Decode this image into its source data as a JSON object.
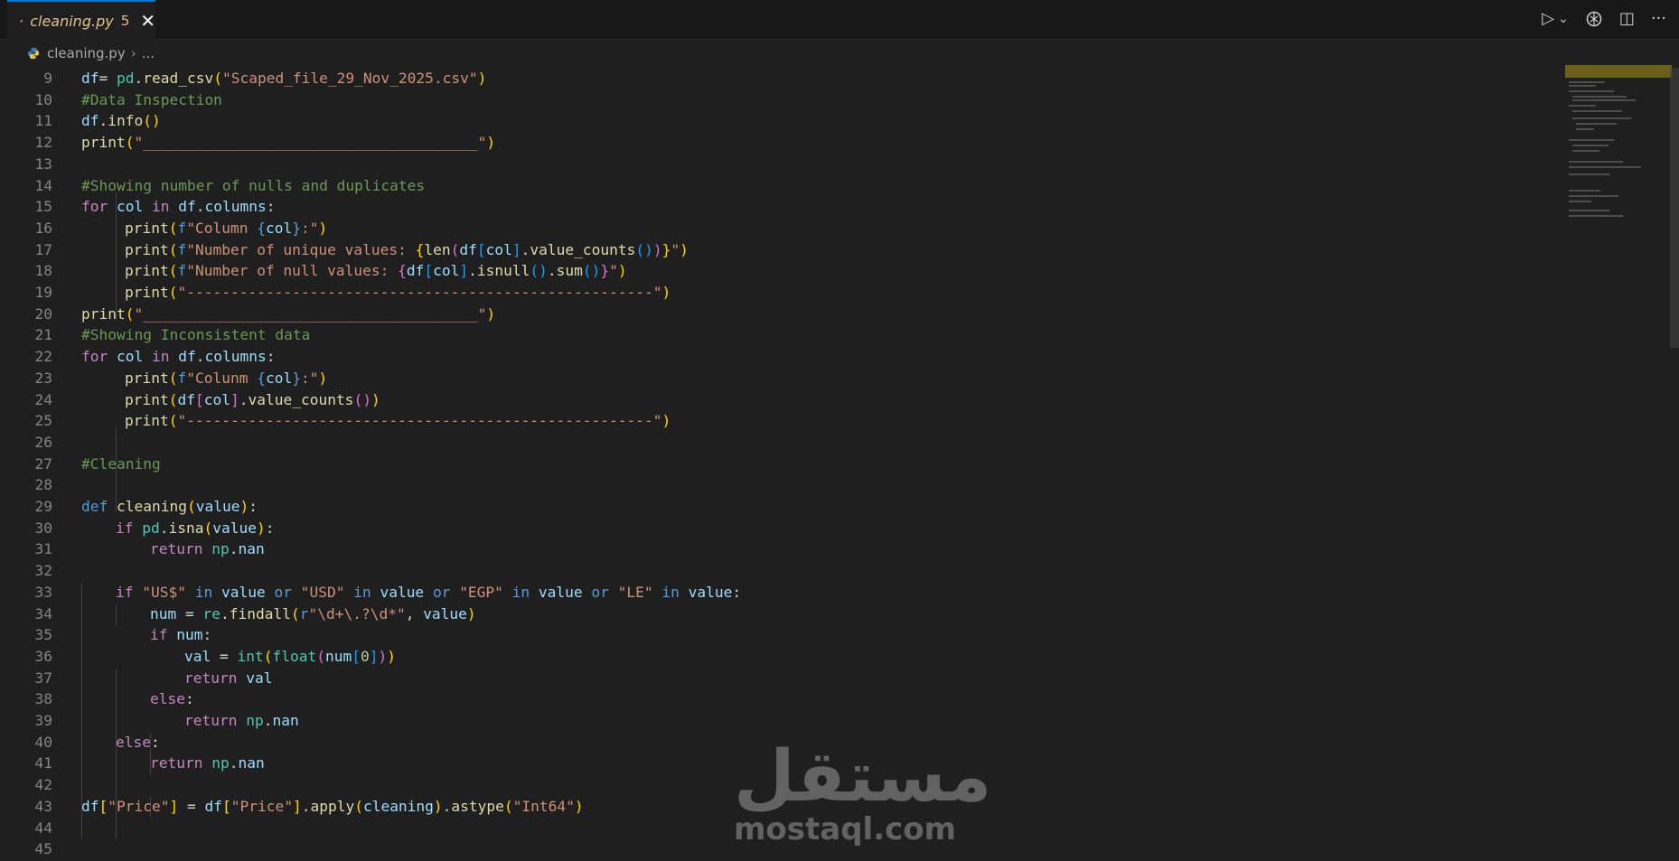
{
  "tab": {
    "title": "cleaning.py",
    "problems": "5",
    "close_glyph": "✕"
  },
  "breadcrumb": {
    "file": "cleaning.py",
    "separator": "›",
    "more": "..."
  },
  "actions": {
    "run_glyph": "▷",
    "dropdown_glyph": "⌄",
    "split_glyph": "◫",
    "more_glyph": "···"
  },
  "editor": {
    "line_numbers": [
      "9",
      "10",
      "11",
      "12",
      "13",
      "14",
      "15",
      "16",
      "17",
      "18",
      "19",
      "20",
      "21",
      "22",
      "23",
      "24",
      "25",
      "26",
      "27",
      "28",
      "29",
      "30",
      "31",
      "32",
      "33",
      "34",
      "35",
      "36",
      "37",
      "38",
      "39",
      "40",
      "41",
      "42",
      "43",
      "44",
      "45"
    ],
    "t": {
      "df": "df",
      "eq": "= ",
      "pd": "pd",
      "dot": ".",
      "read_csv": "read_csv",
      "lp": "(",
      "rp": ")",
      "csv": "\"Scaped_file_29_Nov_2025.csv\"",
      "c10": "#Data Inspection",
      "info": "info",
      "print": "print",
      "line_str": "\"______________________________________\"",
      "c14": "#Showing number of nulls and duplicates",
      "for": "for",
      "col": "col",
      "in": "in",
      "columns": "columns",
      "colon": ":",
      "fpref": "f",
      "s16a": "\"Column ",
      "lb": "{",
      "rb": "}",
      "s16b": ":\"",
      "s17a": "\"Number of unique values: ",
      "len": "len",
      "lsq": "[",
      "rsq": "]",
      "value_counts": "value_counts",
      "s17b": "\"",
      "s18a": "\"Number of null values: ",
      "isnull": "isnull",
      "sum": "sum",
      "dash_str": "\"-----------------------------------------------------\"",
      "c21": "#Showing Inconsistent data",
      "s23a": "\"Colunm ",
      "c27": "#Cleaning",
      "def": "def",
      "cleaning": "cleaning",
      "value": "value",
      "if": "if",
      "isna": "isna",
      "return": "return",
      "np": "np",
      "nan": "nan",
      "usd_sym": "\"US$\"",
      "usd": "\"USD\"",
      "or": "or",
      "egp": "\"EGP\"",
      "le": "\"LE\"",
      "num": "num",
      "eq2": " = ",
      "re": "re",
      "findall": "findall",
      "rpref": "r",
      "regex": "\"\\d+\\.?\\d*\"",
      "comma": ", ",
      "val": "val",
      "int": "int",
      "float": "float",
      "zero": "0",
      "else": "else",
      "price": "\"Price\"",
      "apply": "apply",
      "astype": "astype",
      "int64": "\"Int64\""
    }
  },
  "watermark": {
    "arabic": "مستقل",
    "latin": "mostaql.com"
  },
  "colors": {
    "accent": "#0078d4",
    "modified": "#e2c08d",
    "background": "#1f1f1f"
  }
}
